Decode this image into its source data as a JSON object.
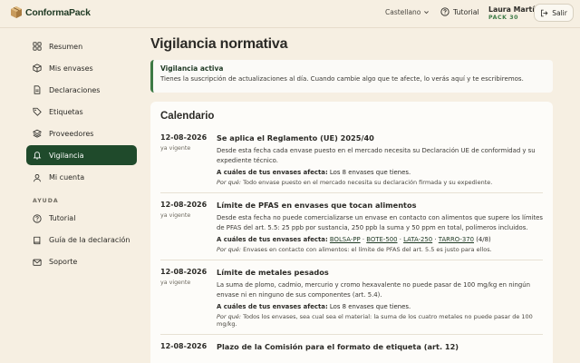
{
  "header": {
    "logo_text": "ConformaPack",
    "language": "Castellano",
    "tutorial": "Tutorial",
    "user_name": "Laura Martín",
    "user_pack": "PACK 30",
    "logout": "Salir"
  },
  "sidebar": {
    "items": [
      {
        "label": "Resumen",
        "icon": "grid-icon"
      },
      {
        "label": "Mis envases",
        "icon": "box-icon"
      },
      {
        "label": "Declaraciones",
        "icon": "document-icon"
      },
      {
        "label": "Etiquetas",
        "icon": "tag-icon"
      },
      {
        "label": "Proveedores",
        "icon": "layers-icon"
      },
      {
        "label": "Vigilancia",
        "icon": "bell-icon",
        "active": true
      },
      {
        "label": "Mi cuenta",
        "icon": "user-icon"
      }
    ],
    "help_label": "AYUDA",
    "help_items": [
      {
        "label": "Tutorial",
        "icon": "help-icon"
      },
      {
        "label": "Guía de la declaración",
        "icon": "book-icon"
      },
      {
        "label": "Soporte",
        "icon": "mail-icon"
      }
    ]
  },
  "main": {
    "title": "Vigilancia normativa",
    "alert": {
      "title": "Vigilancia activa",
      "text": "Tienes la suscripción de actualizaciones al día. Cuando cambie algo que te afecte, lo verás aquí y te escribiremos."
    },
    "calendar": {
      "title": "Calendario",
      "entries": [
        {
          "date": "12-08-2026",
          "status": "ya vigente",
          "title": "Se aplica el Reglamento (UE) 2025/40",
          "desc": "Desde esta fecha cada envase puesto en el mercado necesita su Declaración UE de conformidad y su expediente técnico.",
          "affects_label": "A cuáles de tus envases afecta:",
          "affects_value": "Los 8 envases que tienes.",
          "why_label": "Por qué:",
          "why_text": "Todo envase puesto en el mercado necesita su declaración firmada y su expediente."
        },
        {
          "date": "12-08-2026",
          "status": "ya vigente",
          "title": "Límite de PFAS en envases que tocan alimentos",
          "desc": "Desde esta fecha no puede comercializarse un envase en contacto con alimentos que supere los límites de PFAS del art. 5.5: 25 ppb por sustancia, 250 ppb la suma y 50 ppm en total, polímeros incluidos.",
          "affects_label": "A cuáles de tus envases afecta:",
          "affects_tags": [
            "BOLSA-PP",
            "BOTE-500",
            "LATA-250",
            "TARRO-370"
          ],
          "affects_sep": "·",
          "affects_count": "(4/8)",
          "why_label": "Por qué:",
          "why_text": "Envases en contacto con alimentos: el límite de PFAS del art. 5.5 es justo para ellos."
        },
        {
          "date": "12-08-2026",
          "status": "ya vigente",
          "title": "Límite de metales pesados",
          "desc": "La suma de plomo, cadmio, mercurio y cromo hexavalente no puede pasar de 100 mg/kg en ningún envase ni en ninguno de sus componentes (art. 5.4).",
          "affects_label": "A cuáles de tus envases afecta:",
          "affects_value": "Los 8 envases que tienes.",
          "why_label": "Por qué:",
          "why_text": "Todos los envases, sea cual sea el material: la suma de los cuatro metales no puede pasar de 100 mg/kg."
        },
        {
          "date": "12-08-2026",
          "status": "",
          "title": "Plazo de la Comisión para el formato de etiqueta (art. 12)",
          "desc": "",
          "affects_label": "",
          "affects_value": "",
          "why_label": "",
          "why_text": ""
        }
      ]
    }
  }
}
